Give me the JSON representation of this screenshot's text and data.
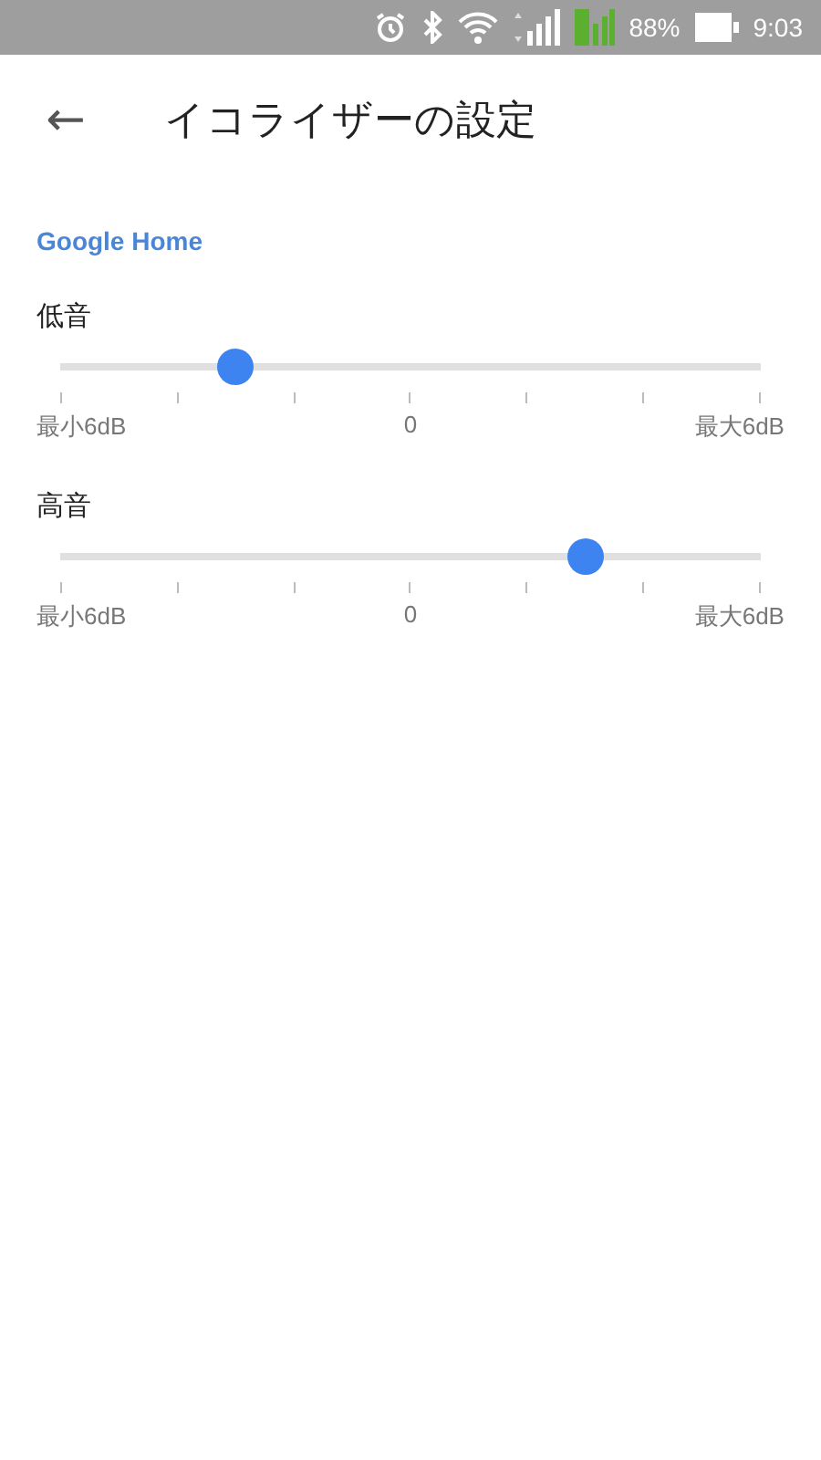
{
  "status_bar": {
    "battery_text": "88%",
    "time": "9:03"
  },
  "header": {
    "back": "←",
    "title": "イコライザーの設定"
  },
  "device": "Google Home",
  "sliders": [
    {
      "label": "低音",
      "level": 0.25,
      "min_label": "最小6dB",
      "mid_label": "0",
      "max_label": "最大6dB"
    },
    {
      "label": "高音",
      "level": 0.75,
      "min_label": "最小6dB",
      "mid_label": "0",
      "max_label": "最大6dB"
    }
  ]
}
